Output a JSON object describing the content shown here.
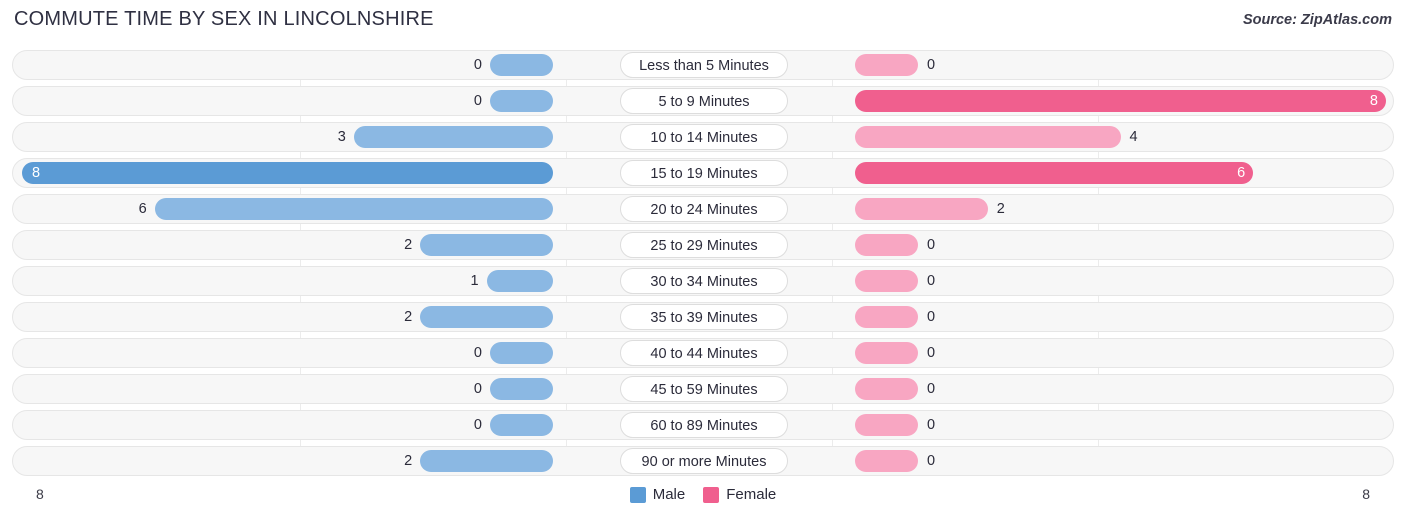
{
  "header": {
    "title": "COMMUTE TIME BY SEX IN LINCOLNSHIRE",
    "source": "Source: ZipAtlas.com"
  },
  "axis": {
    "left_max": "8",
    "right_max": "8"
  },
  "legend": {
    "male_label": "Male",
    "female_label": "Female",
    "male_color": "#5b9bd5",
    "female_color": "#f05f8e"
  },
  "colors": {
    "male_base": "#8bb8e3",
    "male_high": "#5b9bd5",
    "female_base": "#f8a6c2",
    "female_high": "#f05f8e",
    "track": "#f7f7f7",
    "track_border": "#e6e6e6"
  },
  "chart_data": {
    "type": "bar",
    "title": "COMMUTE TIME BY SEX IN LINCOLNSHIRE",
    "subtitle": "",
    "orientation": "horizontal-diverging",
    "xlabel": "",
    "ylabel": "",
    "xlim": [
      0,
      8
    ],
    "grid": false,
    "legend_position": "bottom-center",
    "categories": [
      "Less than 5 Minutes",
      "5 to 9 Minutes",
      "10 to 14 Minutes",
      "15 to 19 Minutes",
      "20 to 24 Minutes",
      "25 to 29 Minutes",
      "30 to 34 Minutes",
      "35 to 39 Minutes",
      "40 to 44 Minutes",
      "45 to 59 Minutes",
      "60 to 89 Minutes",
      "90 or more Minutes"
    ],
    "series": [
      {
        "name": "Male",
        "values": [
          0,
          0,
          3,
          8,
          6,
          2,
          1,
          2,
          0,
          0,
          0,
          2
        ]
      },
      {
        "name": "Female",
        "values": [
          0,
          8,
          4,
          6,
          2,
          0,
          0,
          0,
          0,
          0,
          0,
          0
        ]
      }
    ]
  },
  "rows": [
    {
      "category": "Less than 5 Minutes",
      "male": "0",
      "female": "0"
    },
    {
      "category": "5 to 9 Minutes",
      "male": "0",
      "female": "8"
    },
    {
      "category": "10 to 14 Minutes",
      "male": "3",
      "female": "4"
    },
    {
      "category": "15 to 19 Minutes",
      "male": "8",
      "female": "6"
    },
    {
      "category": "20 to 24 Minutes",
      "male": "6",
      "female": "2"
    },
    {
      "category": "25 to 29 Minutes",
      "male": "2",
      "female": "0"
    },
    {
      "category": "30 to 34 Minutes",
      "male": "1",
      "female": "0"
    },
    {
      "category": "35 to 39 Minutes",
      "male": "2",
      "female": "0"
    },
    {
      "category": "40 to 44 Minutes",
      "male": "0",
      "female": "0"
    },
    {
      "category": "45 to 59 Minutes",
      "male": "0",
      "female": "0"
    },
    {
      "category": "60 to 89 Minutes",
      "male": "0",
      "female": "0"
    },
    {
      "category": "90 or more Minutes",
      "male": "2",
      "female": "0"
    }
  ]
}
